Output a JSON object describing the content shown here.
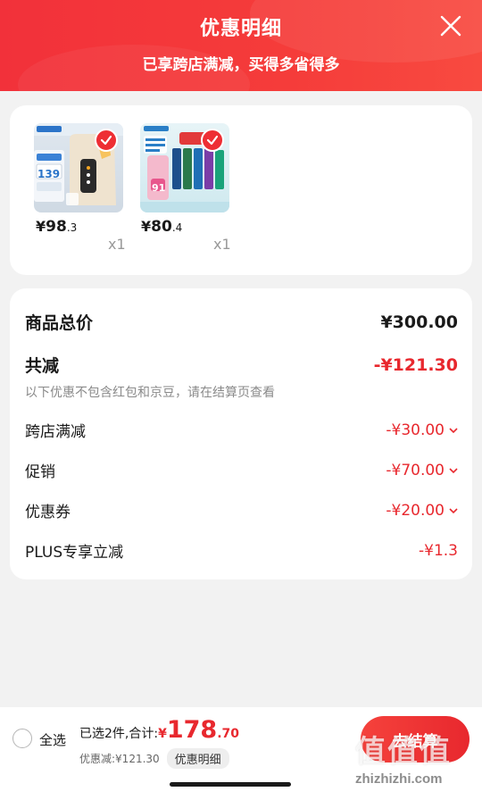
{
  "header": {
    "title": "优惠明细",
    "subtitle": "已享跨店满减，买得多省得多",
    "close_icon": "close-icon"
  },
  "products": [
    {
      "currency": "¥",
      "price_int": "98",
      "price_dec": ".3",
      "qty": "x1",
      "thumb_icon": "soymilk-maker-image",
      "badge_text": "139"
    },
    {
      "currency": "¥",
      "price_int": "80",
      "price_dec": ".4",
      "qty": "x1",
      "thumb_icon": "toothpaste-set-image",
      "badge_text": "91"
    }
  ],
  "summary": {
    "total_label": "商品总价",
    "total_value": "¥300.00",
    "reduce_label": "共减",
    "reduce_value": "-¥121.30",
    "hint": "以下优惠不包含红包和京豆，请在结算页查看",
    "items": [
      {
        "label": "跨店满减",
        "value": "-¥30.00",
        "expandable": true
      },
      {
        "label": "促销",
        "value": "-¥70.00",
        "expandable": true
      },
      {
        "label": "优惠券",
        "value": "-¥20.00",
        "expandable": true
      },
      {
        "label": "PLUS专享立减",
        "value": "-¥1.3",
        "expandable": false
      }
    ]
  },
  "bottom_bar": {
    "select_all": "全选",
    "selected_text": "已选2件,合计:",
    "total_currency": "¥",
    "total_int": "178",
    "total_dec": ".70",
    "discount_text": "优惠减:¥121.30",
    "detail_label": "优惠明细",
    "checkout_label": "去结算"
  },
  "watermark": {
    "text": "值值值",
    "url": "zhizhizhi.com"
  },
  "colors": {
    "accent_red": "#e8282e",
    "header_red": "#f2313a"
  }
}
